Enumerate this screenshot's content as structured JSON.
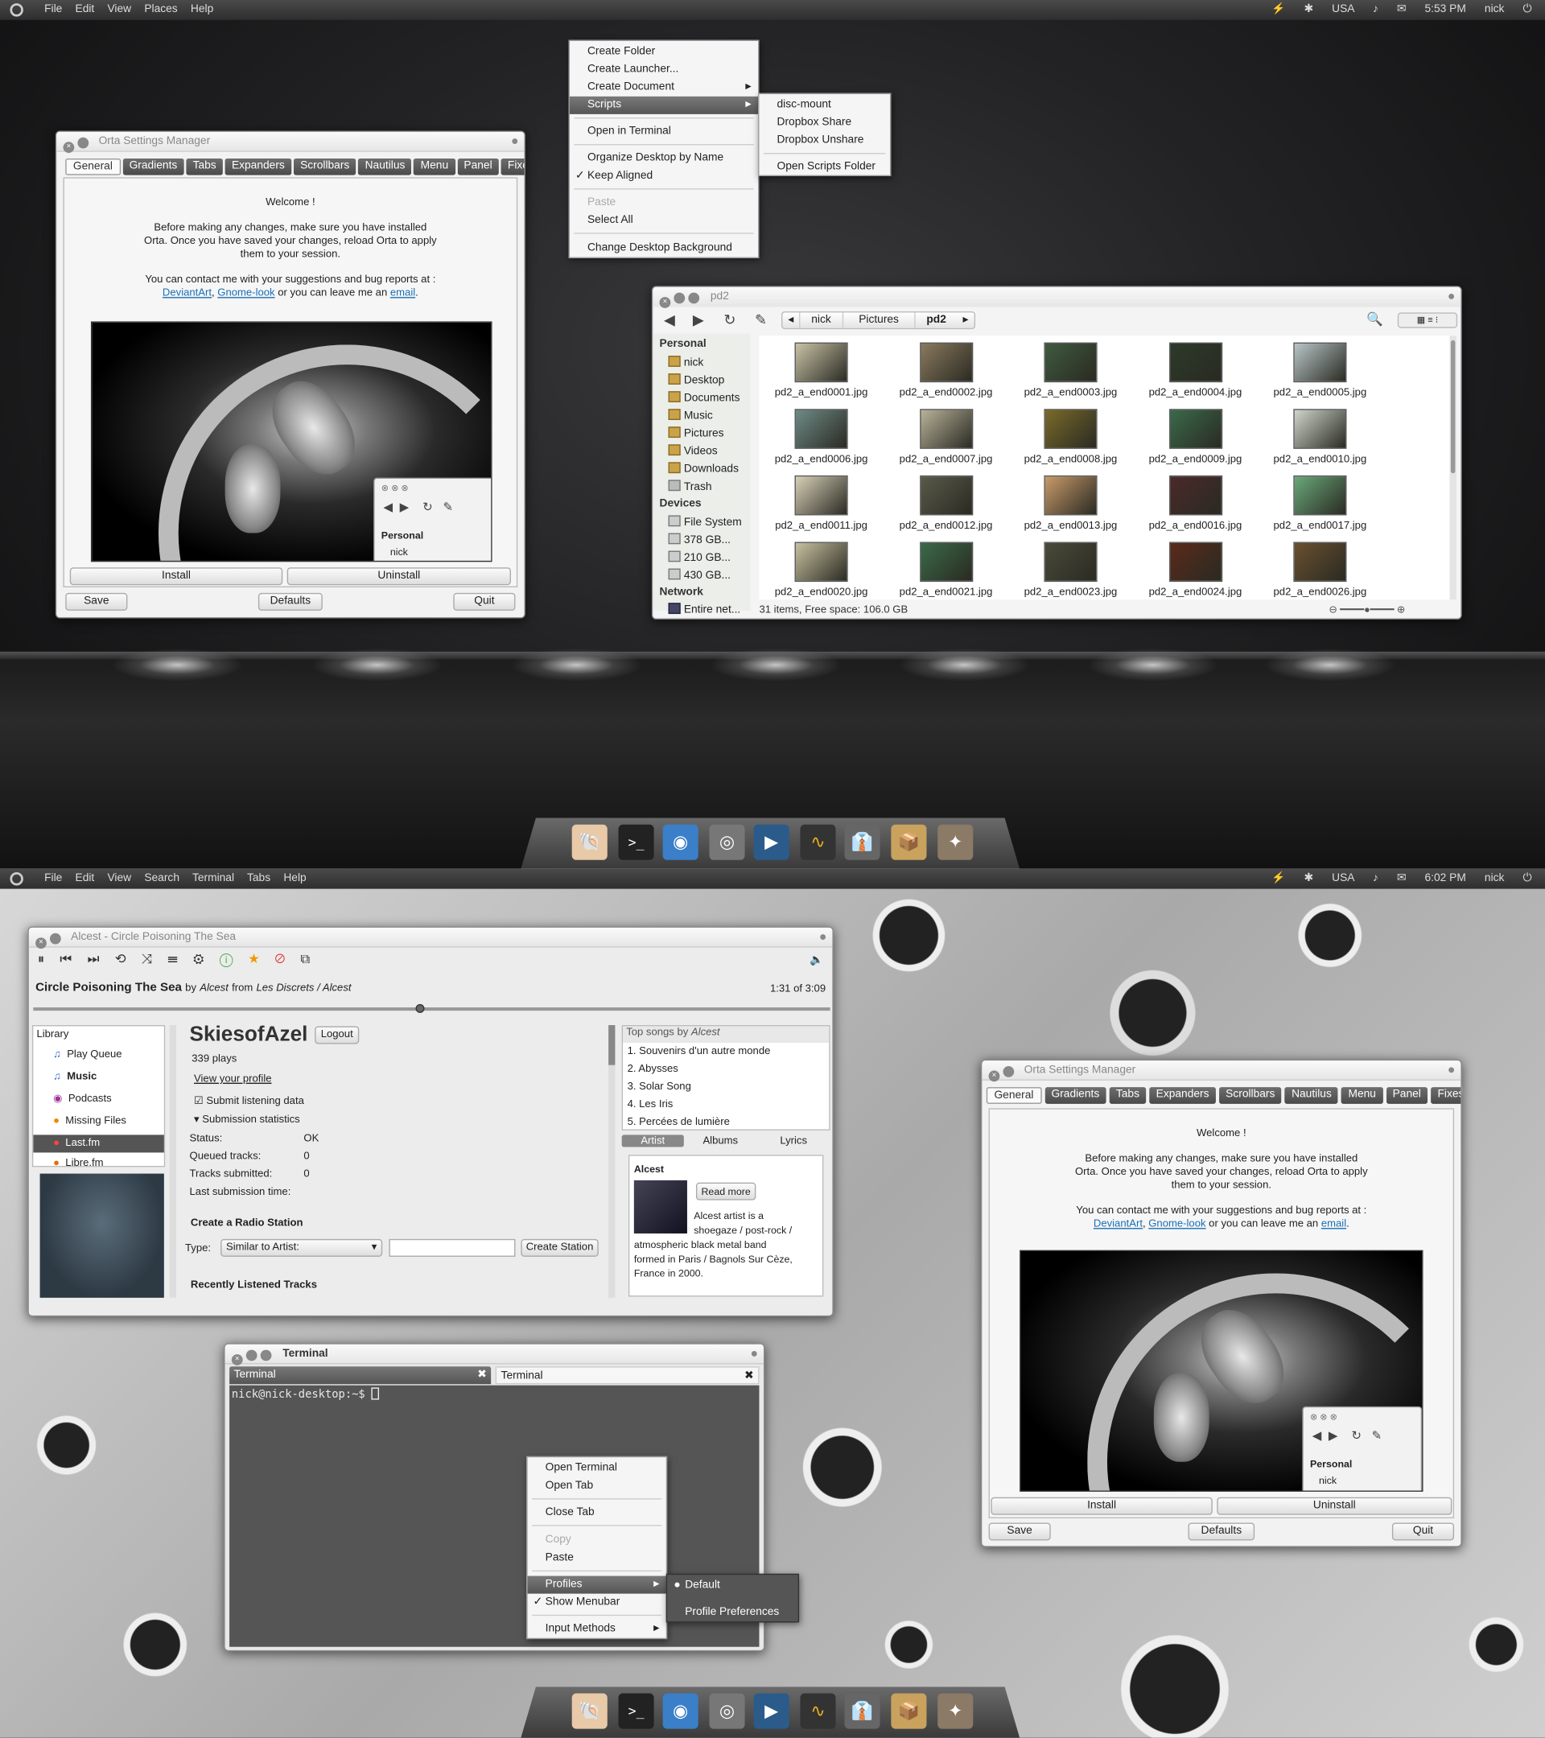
{
  "screen1": {
    "panel": {
      "menus": [
        "File",
        "Edit",
        "View",
        "Places",
        "Help"
      ],
      "keyboard": "USA",
      "time": "5:53 PM",
      "user": "nick"
    },
    "orta": {
      "title": "Orta Settings Manager",
      "tabs": [
        "General",
        "Gradients",
        "Tabs",
        "Expanders",
        "Scrollbars",
        "Nautilus",
        "Menu",
        "Panel",
        "Fixes"
      ],
      "welcome": "Welcome !",
      "p1_l1": "Before making any changes, make sure you have installed",
      "p1_l2": "Orta. Once you have saved your changes, reload Orta to apply",
      "p1_l3": "them to your session.",
      "p2_l1": "You can contact me with your suggestions and bug reports at :",
      "link1": "DeviantArt",
      "sep": ",",
      "link2": "Gnome-look",
      "mid": "or you can leave me an",
      "link3": "email",
      "end": ".",
      "mini_personal": "Personal",
      "mini_nick": "nick",
      "install": "Install",
      "uninstall": "Uninstall",
      "save": "Save",
      "defaults": "Defaults",
      "quit": "Quit"
    },
    "ctxmenu": {
      "items": [
        "Create Folder",
        "Create Launcher...",
        "Create Document",
        "Scripts",
        "Open in Terminal",
        "Organize Desktop by Name",
        "Keep Aligned",
        "Paste",
        "Select All",
        "Change Desktop Background"
      ],
      "check": "✓",
      "sub": [
        "disc-mount",
        "Dropbox Share",
        "Dropbox Unshare",
        "Open Scripts Folder"
      ]
    },
    "fm": {
      "title": "pd2",
      "crumbs": [
        "nick",
        "Pictures",
        "pd2"
      ],
      "side_personal": "Personal",
      "places": [
        "nick",
        "Desktop",
        "Documents",
        "Music",
        "Pictures",
        "Videos",
        "Downloads",
        "Trash"
      ],
      "side_devices": "Devices",
      "devices": [
        "File System",
        "378 GB...",
        "210 GB...",
        "430 GB..."
      ],
      "side_network": "Network",
      "network": [
        "Entire net..."
      ],
      "files": [
        "pd2_a_end0001.jpg",
        "pd2_a_end0002.jpg",
        "pd2_a_end0003.jpg",
        "pd2_a_end0004.jpg",
        "pd2_a_end0005.jpg",
        "pd2_a_end0006.jpg",
        "pd2_a_end0007.jpg",
        "pd2_a_end0008.jpg",
        "pd2_a_end0009.jpg",
        "pd2_a_end0010.jpg",
        "pd2_a_end0011.jpg",
        "pd2_a_end0012.jpg",
        "pd2_a_end0013.jpg",
        "pd2_a_end0016.jpg",
        "pd2_a_end0017.jpg",
        "pd2_a_end0020.jpg",
        "pd2_a_end0021.jpg",
        "pd2_a_end0023.jpg",
        "pd2_a_end0024.jpg",
        "pd2_a_end0026.jpg"
      ],
      "status": "31 items, Free space: 106.0 GB"
    }
  },
  "screen2": {
    "panel": {
      "menus": [
        "File",
        "Edit",
        "View",
        "Search",
        "Terminal",
        "Tabs",
        "Help"
      ],
      "keyboard": "USA",
      "time": "6:02 PM",
      "user": "nick"
    },
    "amarok": {
      "title": "Alcest - Circle Poisoning The Sea",
      "song": "Circle Poisoning The Sea",
      "by": "by",
      "artist": "Alcest",
      "from": "from",
      "album": "Les Discrets / Alcest",
      "time": "1:31 of 3:09",
      "library": "Library",
      "side": [
        "Play Queue",
        "Music",
        "Podcasts",
        "Missing Files",
        "Last.fm",
        "Libre.fm"
      ],
      "user": "SkiesofAzel",
      "logout": "Logout",
      "plays": "339 plays",
      "view_profile": "View your profile",
      "submit": "Submit listening data",
      "substats": "Submission statistics",
      "status_label": "Status:",
      "status_val": "OK",
      "queued_label": "Queued tracks:",
      "queued_val": "0",
      "submitted_label": "Tracks submitted:",
      "submitted_val": "0",
      "last_label": "Last submission time:",
      "radio": "Create a Radio Station",
      "type_label": "Type:",
      "type_val": "Similar to Artist:",
      "create_station": "Create Station",
      "recent": "Recently Listened Tracks",
      "top_songs": "Top songs by",
      "top_artist": "Alcest",
      "songs": [
        "1.   Souvenirs d'un autre monde",
        "2.   Abysses",
        "3.   Solar Song",
        "4.   Les Iris",
        "5.   Percées de lumière"
      ],
      "tabs": [
        "Artist",
        "Albums",
        "Lyrics"
      ],
      "artist_name": "Alcest",
      "read_more": "Read more",
      "bio": [
        "Alcest artist is a",
        "shoegaze / post-rock /",
        "atmospheric black metal band",
        "formed in Paris / Bagnols Sur Cèze,",
        "France in 2000."
      ]
    },
    "terminal": {
      "title": "Terminal",
      "tab1": "Terminal",
      "tab2": "Terminal",
      "prompt": "nick@nick-desktop:~$",
      "menu": [
        "Open Terminal",
        "Open Tab",
        "Close Tab",
        "Copy",
        "Paste",
        "Profiles",
        "Show Menubar",
        "Input Methods"
      ],
      "check": "✓",
      "sub": [
        "Default",
        "Profile Preferences"
      ]
    },
    "orta": {
      "title": "Orta Settings Manager",
      "tabs": [
        "General",
        "Gradients",
        "Tabs",
        "Expanders",
        "Scrollbars",
        "Nautilus",
        "Menu",
        "Panel",
        "Fixes"
      ]
    }
  }
}
